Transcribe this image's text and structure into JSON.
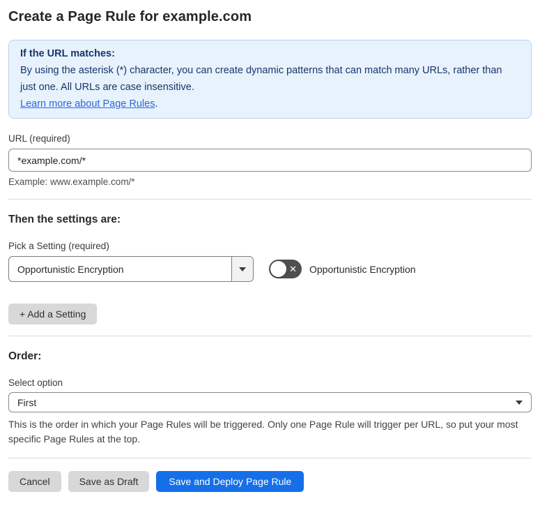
{
  "page": {
    "title": "Create a Page Rule for example.com"
  },
  "info_box": {
    "heading": "If the URL matches:",
    "body": "By using the asterisk (*) character, you can create dynamic patterns that can match many URLs, rather than just one. All URLs are case insensitive.",
    "link_label": "Learn more about Page Rules",
    "link_suffix": "."
  },
  "url_field": {
    "label": "URL (required)",
    "value": "*example.com/*",
    "example": "Example: www.example.com/*"
  },
  "settings": {
    "heading": "Then the settings are:",
    "picker_label": "Pick a Setting (required)",
    "selected_setting": "Opportunistic Encryption",
    "toggle": {
      "state": "off",
      "off_glyph": "✕",
      "label": "Opportunistic Encryption"
    },
    "add_button_label": "+ Add a Setting"
  },
  "order": {
    "heading": "Order:",
    "select_label": "Select option",
    "selected_option": "First",
    "description": "This is the order in which your Page Rules will be triggered. Only one Page Rule will trigger per URL, so put your most specific Page Rules at the top."
  },
  "actions": {
    "cancel_label": "Cancel",
    "save_draft_label": "Save as Draft",
    "save_deploy_label": "Save and Deploy Page Rule"
  },
  "colors": {
    "info_background": "#e8f2fd",
    "info_border": "#b3d2f0",
    "info_text": "#15366b",
    "link": "#2d66d9",
    "primary_button": "#156fe8",
    "gray_button": "#d8d8d8",
    "toggle_off": "#4f4f4f"
  }
}
